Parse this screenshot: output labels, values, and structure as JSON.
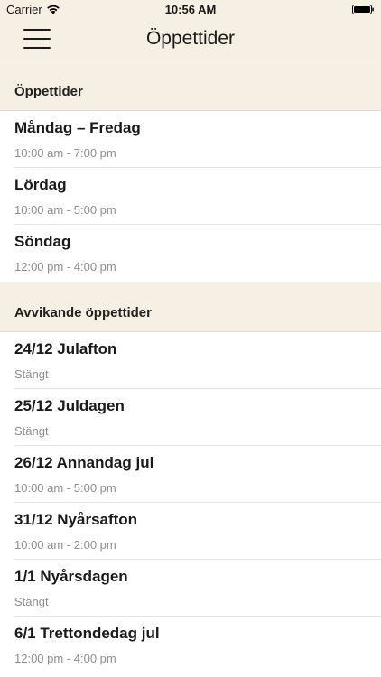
{
  "status_bar": {
    "carrier": "Carrier",
    "time": "10:56 AM",
    "wifi_icon": "wifi-icon",
    "battery_icon": "battery-icon"
  },
  "nav": {
    "title": "Öppettider",
    "menu_icon": "hamburger-menu-icon"
  },
  "regular": {
    "header": "Öppettider",
    "rows": [
      {
        "title": "Måndag – Fredag",
        "hours": "10:00 am - 7:00 pm"
      },
      {
        "title": "Lördag",
        "hours": "10:00 am - 5:00 pm"
      },
      {
        "title": "Söndag",
        "hours": "12:00 pm - 4:00 pm"
      }
    ]
  },
  "deviating": {
    "header": "Avvikande öppettider",
    "rows": [
      {
        "title": "24/12 Julafton",
        "hours": "Stängt"
      },
      {
        "title": "25/12 Juldagen",
        "hours": "Stängt"
      },
      {
        "title": "26/12 Annandag jul",
        "hours": "10:00 am - 5:00 pm"
      },
      {
        "title": "31/12 Nyårsafton",
        "hours": "10:00 am - 2:00 pm"
      },
      {
        "title": "1/1 Nyårsdagen",
        "hours": "Stängt"
      },
      {
        "title": "6/1 Trettondedag jul",
        "hours": "12:00 pm - 4:00 pm"
      }
    ]
  },
  "colors": {
    "header_bg": "#f6efe3",
    "text": "#1a1a1a",
    "subtext": "#8e8e8e"
  }
}
